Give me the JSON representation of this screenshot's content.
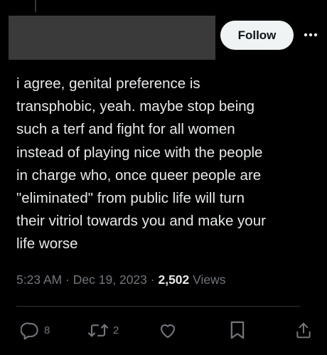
{
  "post": {
    "text": "i agree, genital preference is\ntransphobic, yeah. maybe stop being\nsuch a terf and fight for all women\ninstead of playing nice with the people\nin charge who, once queer people are\n\"eliminated\" from public life will turn\ntheir vitriol towards you and make your\nlife worse",
    "time": "5:23 AM",
    "date": "Dec 19, 2023",
    "separator": "·",
    "views_count": "2,502",
    "views_label": "Views"
  },
  "header": {
    "follow_label": "Follow",
    "more_icon": "more-horizontal-icon"
  },
  "actions": {
    "reply_count": "8",
    "repost_count": "2",
    "icons": [
      "reply-icon",
      "repost-icon",
      "like-icon",
      "bookmark-icon",
      "share-icon"
    ]
  },
  "colors": {
    "background": "#000000",
    "text": "#e7e9ea",
    "muted": "#71767b",
    "follow_bg": "#eff3f4",
    "redacted": "#3a3a3a"
  }
}
